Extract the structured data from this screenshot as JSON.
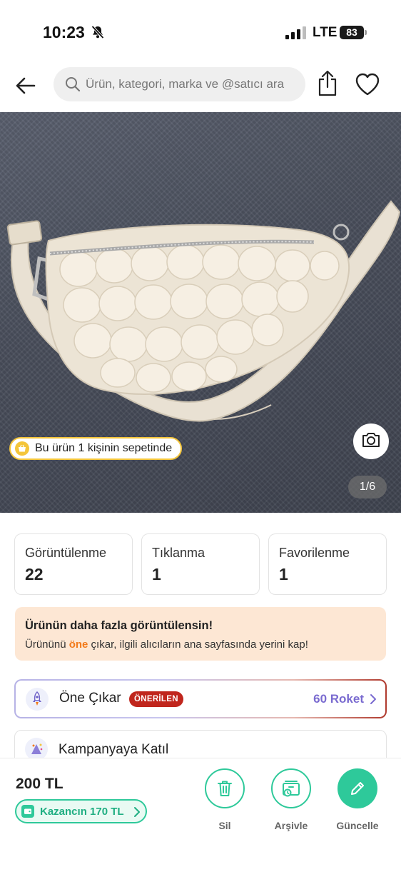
{
  "status_bar": {
    "time": "10:23",
    "network": "LTE",
    "battery": "83"
  },
  "search": {
    "placeholder": "Ürün, kategori, marka ve @satıcı ara"
  },
  "photo": {
    "basket_badge": "Bu ürün 1 kişinin sepetinde",
    "counter": "1/6"
  },
  "stats": [
    {
      "label": "Görüntülenme",
      "value": "22"
    },
    {
      "label": "Tıklanma",
      "value": "1"
    },
    {
      "label": "Favorilenme",
      "value": "1"
    }
  ],
  "promo": {
    "title": "Ürünün daha fazla görüntülensin!",
    "desc_before": "Ürününü ",
    "desc_highlight": "öne",
    "desc_after": " çıkar, ilgili alıcıların ana sayfasında yerini kap!"
  },
  "feature": {
    "label": "Öne Çıkar",
    "badge": "ÖNERİLEN",
    "cost": "60 Roket"
  },
  "campaign": {
    "label": "Kampanyaya Katıl"
  },
  "bottom": {
    "price": "200 TL",
    "earnings": "Kazancın 170 TL",
    "actions": {
      "delete": "Sil",
      "archive": "Arşivle",
      "update": "Güncelle"
    }
  },
  "colors": {
    "accent_green": "#2ec99a",
    "highlight_orange": "#f27a1a",
    "badge_red": "#c0261d",
    "roket_purple": "#7a6bd0",
    "basket_yellow": "#f4c53a"
  },
  "icons": [
    "bell-slash-icon",
    "signal-icon",
    "back-arrow-icon",
    "search-icon",
    "share-icon",
    "heart-icon",
    "basket-icon",
    "camera-icon",
    "rocket-icon",
    "campaign-icon",
    "wallet-icon",
    "chevron-right-icon",
    "trash-icon",
    "archive-icon",
    "pencil-icon"
  ]
}
